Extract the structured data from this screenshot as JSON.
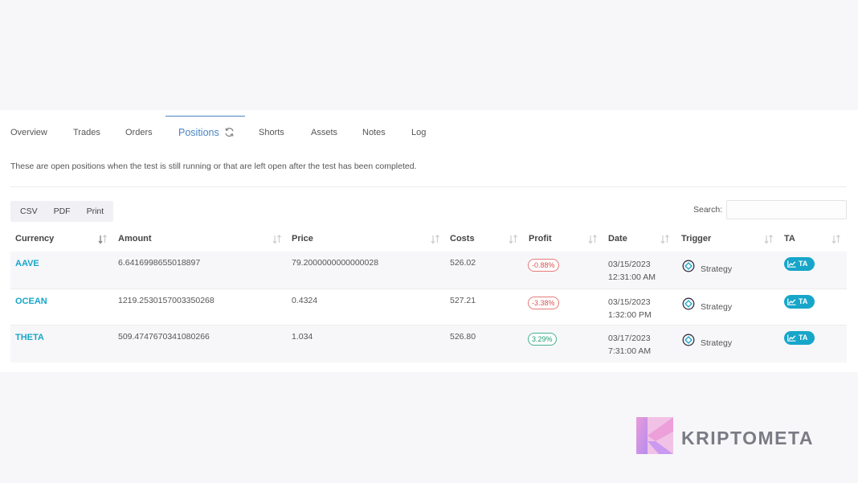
{
  "tabs": [
    {
      "label": "Overview"
    },
    {
      "label": "Trades"
    },
    {
      "label": "Orders"
    },
    {
      "label": "Positions"
    },
    {
      "label": "Shorts"
    },
    {
      "label": "Assets"
    },
    {
      "label": "Notes"
    },
    {
      "label": "Log"
    }
  ],
  "active_tab": "Positions",
  "description": "These are open positions when the test is still running or that are left open after the test has been completed.",
  "export_buttons": {
    "csv": "CSV",
    "pdf": "PDF",
    "print": "Print"
  },
  "search": {
    "label": "Search:",
    "value": ""
  },
  "table": {
    "columns": [
      "Currency",
      "Amount",
      "Price",
      "Costs",
      "Profit",
      "Date",
      "Trigger",
      "TA"
    ],
    "rows": [
      {
        "currency": "AAVE",
        "amount": "6.6416998655018897",
        "price": "79.2000000000000028",
        "costs": "526.02",
        "profit": "-0.88%",
        "profit_sign": "neg",
        "date": "03/15/2023",
        "time": "12:31:00 AM",
        "trigger": "Strategy",
        "ta": "TA"
      },
      {
        "currency": "OCEAN",
        "amount": "1219.2530157003350268",
        "price": "0.4324",
        "costs": "527.21",
        "profit": "-3.38%",
        "profit_sign": "neg",
        "date": "03/15/2023",
        "time": "1:32:00 PM",
        "trigger": "Strategy",
        "ta": "TA"
      },
      {
        "currency": "THETA",
        "amount": "509.4747670341080266",
        "price": "1.034",
        "costs": "526.80",
        "profit": "3.29%",
        "profit_sign": "pos",
        "date": "03/17/2023",
        "time": "7:31:00 AM",
        "trigger": "Strategy",
        "ta": "TA"
      }
    ]
  },
  "watermark": {
    "text": "KRIPTOMETA"
  },
  "colors": {
    "accent": "#4a84c4",
    "currency": "#17a6c9",
    "negative": "#d9534f",
    "positive": "#1f9b72"
  },
  "icons": {
    "tab_refresh": "refresh-icon",
    "sort": "sort-arrows-icon",
    "trigger": "strategy-target-icon",
    "ta": "chart-line-icon"
  }
}
